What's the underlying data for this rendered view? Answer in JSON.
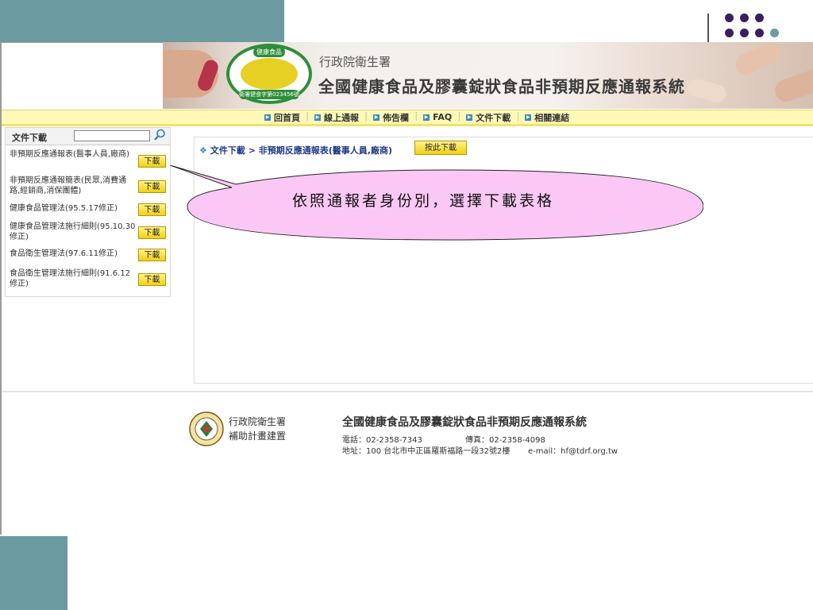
{
  "banner": {
    "agency": "行政院衛生署",
    "title": "全國健康食品及膠囊錠狀食品非預期反應通報系統",
    "logo_top": "健康食品",
    "logo_bottom": "衛署健食字第023456號"
  },
  "nav": {
    "items": [
      {
        "label": "回首頁"
      },
      {
        "label": "線上通報"
      },
      {
        "label": "佈告欄"
      },
      {
        "label": "FAQ"
      },
      {
        "label": "文件下載"
      },
      {
        "label": "相關連結"
      }
    ]
  },
  "sidebar": {
    "title": "文件下載",
    "search_value": "",
    "download_label": "下載",
    "items": [
      {
        "label": "非預期反應通報表(醫事人員,廠商)"
      },
      {
        "label": "非預期反應通報簡表(民眾,消費通路,經銷商,消保團體)"
      },
      {
        "label": "健康食品管理法(95.5.17修正)"
      },
      {
        "label": "健康食品管理法施行細則(95.10.30修正)"
      },
      {
        "label": "食品衛生管理法(97.6.11修正)"
      },
      {
        "label": "食品衛生管理法施行細則(91.6.12修正)"
      }
    ]
  },
  "content": {
    "breadcrumb": "文件下載 > 非預期反應通報表(醫事人員,廠商)",
    "download_button": "按此下載"
  },
  "callout": {
    "text": "依照通報者身份別，選擇下載表格"
  },
  "footer": {
    "agency_line1": "行政院衛生署",
    "agency_line2": "補助計畫建置",
    "title": "全國健康食品及膠囊錠狀食品非預期反應通報系統",
    "phone": "電話：02-2358-7343",
    "fax": "傳真：02-2358-4098",
    "address": "地址：100 台北市中正區羅斯福路一段32號2樓",
    "email": "e-mail：hf@tdrf.org.tw"
  },
  "colors": {
    "slide_accent": "#6b9ba0",
    "dot_purple": "#3b1e5e",
    "nav_bg": "#fff9b8",
    "button_yellow": "#f3cf14",
    "callout_fill": "#fbc8f5",
    "breadcrumb_blue": "#1f3a8a"
  }
}
